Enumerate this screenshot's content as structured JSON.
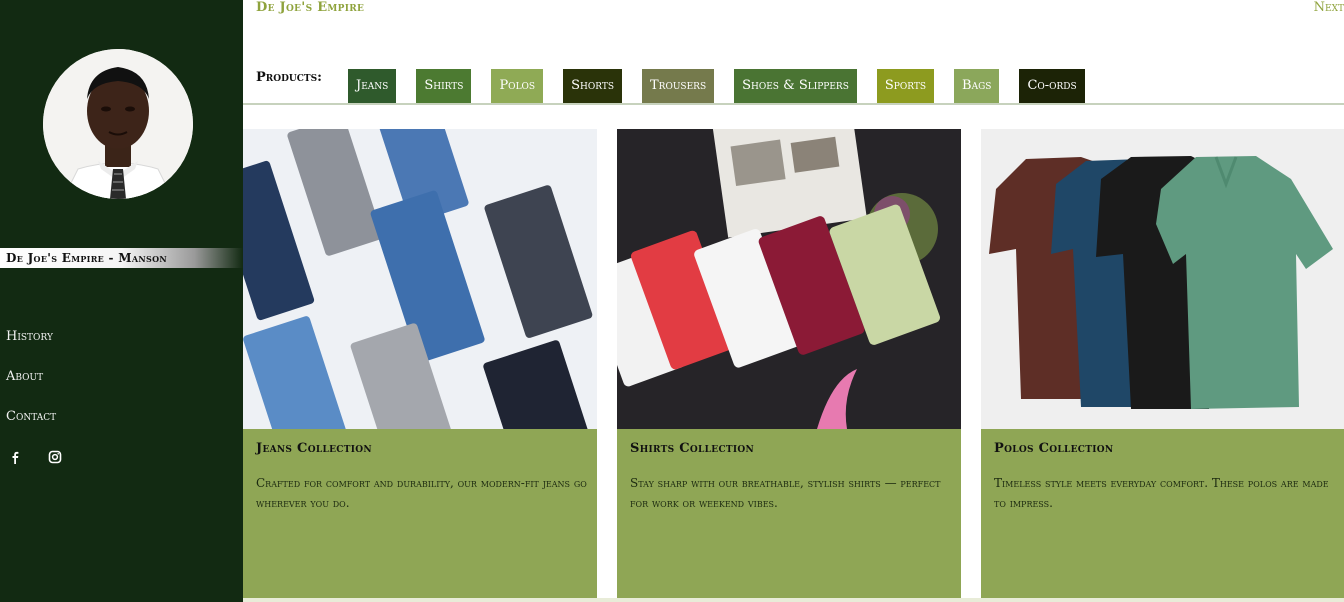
{
  "header": {
    "brand": "De Joe's Empire",
    "next": "Next"
  },
  "sidebar": {
    "name": "De Joe's Empire - Manson",
    "nav": [
      "History",
      "About",
      "Contact"
    ],
    "social": [
      "facebook-icon",
      "instagram-icon"
    ]
  },
  "products": {
    "label": "Products:",
    "tabs": [
      {
        "label": "Jeans",
        "color": "#2f5a2c"
      },
      {
        "label": "Shirts",
        "color": "#4c7a31"
      },
      {
        "label": "Polos",
        "color": "#8faa55"
      },
      {
        "label": "Shorts",
        "color": "#2a3309"
      },
      {
        "label": "Trousers",
        "color": "#757a4c"
      },
      {
        "label": "Shoes & Slippers",
        "color": "#4a7433"
      },
      {
        "label": "Sports",
        "color": "#8d9b1f"
      },
      {
        "label": "Bags",
        "color": "#8ba75b"
      },
      {
        "label": "Co-ords",
        "color": "#1c2306"
      }
    ]
  },
  "cards": [
    {
      "title": "Jeans Collection",
      "text": "Crafted for comfort and durability, our modern-fit jeans go wherever you do."
    },
    {
      "title": "Shirts Collection",
      "text": "Stay sharp with our breathable, stylish shirts — perfect for work or weekend vibes."
    },
    {
      "title": "Polos Collection",
      "text": "Timeless style meets everyday comfort. These polos are made to impress."
    }
  ]
}
